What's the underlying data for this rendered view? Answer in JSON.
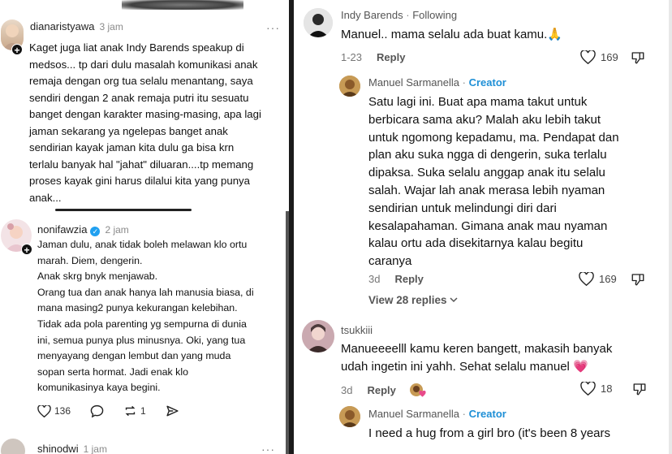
{
  "left": {
    "comment1": {
      "username": "dianaristyawa",
      "time": "3 jam",
      "more": "···",
      "lines": [
        "Kaget juga liat anak Indy Barends speakup di",
        "medsos... tp dari dulu masalah komunikasi anak",
        "remaja dengan org tua selalu menantang, saya",
        "sendiri dengan 2 anak remaja putri itu sesuatu",
        "banget dengan karakter masing-masing, apa lagi",
        "jaman sekarang ya ngelepas banget anak",
        "sendirian kayak jaman kita dulu ga bisa krn",
        "terlalu banyak hal \"jahat\" diluaran....tp memang",
        "proses kayak gini harus dilalui kita yang punya",
        "anak..."
      ]
    },
    "comment2": {
      "username": "nonifawzia",
      "time": "2 jam",
      "lines": [
        "Jaman dulu, anak tidak boleh melawan klo ortu",
        "marah. Diem, dengerin.",
        "Anak skrg bnyk menjawab.",
        "Orang tua dan anak hanya lah manusia biasa, di",
        "mana masing2 punya kekurangan kelebihan.",
        "Tidak ada pola parenting yg sempurna di dunia",
        "ini, semua punya plus minusnya. Oki, yang tua",
        "menyayang dengan lembut dan yang muda",
        "sopan serta hormat. Jadi enak klo",
        "komunikasinya kaya begini."
      ],
      "likes": "136",
      "reposts": "1"
    },
    "comment3": {
      "username": "shinodwi",
      "time": "1 jam"
    }
  },
  "right": {
    "c1": {
      "username": "Indy Barends",
      "dot": "·",
      "status": "Following",
      "text": "Manuel.. mama selalu ada buat kamu.",
      "emoji": "🙏",
      "date": "1-23",
      "reply": "Reply",
      "likes": "169"
    },
    "c2": {
      "username": "Manuel Sarmanella",
      "dot": "·",
      "badge": "Creator",
      "lines": [
        "Satu lagi ini. Buat apa mama takut untuk",
        "berbicara sama aku? Malah aku lebih takut",
        "untuk ngomong kepadamu, ma. Pendapat dan",
        "plan aku suka ngga di dengerin, suka terlalu",
        "dipaksa. Suka selalu anggap anak itu selalu",
        "salah. Wajar lah anak merasa lebih nyaman",
        "sendirian untuk melindungi diri dari",
        "kesalapahaman. Gimana anak mau nyaman",
        "kalau ortu ada disekitarnya kalau begitu",
        "caranya"
      ],
      "date": "3d",
      "reply": "Reply",
      "likes": "169",
      "view_replies": "View 28 replies"
    },
    "c3": {
      "username": "tsukkiii",
      "lines": [
        "Manueeeelll kamu keren bangett, makasih banyak",
        "udah ingetin ini yahh. Sehat selalu manuel"
      ],
      "emoji": "💗",
      "date": "3d",
      "reply": "Reply",
      "likes": "18"
    },
    "c4": {
      "username": "Manuel Sarmanella",
      "dot": "·",
      "badge": "Creator",
      "text": "I need a hug from a girl bro (it's been 8 years"
    }
  },
  "colors": {
    "creator_blue": "#1e8fd6",
    "verified_blue": "#20a0f0",
    "heart_pink": "#e84a8a"
  }
}
